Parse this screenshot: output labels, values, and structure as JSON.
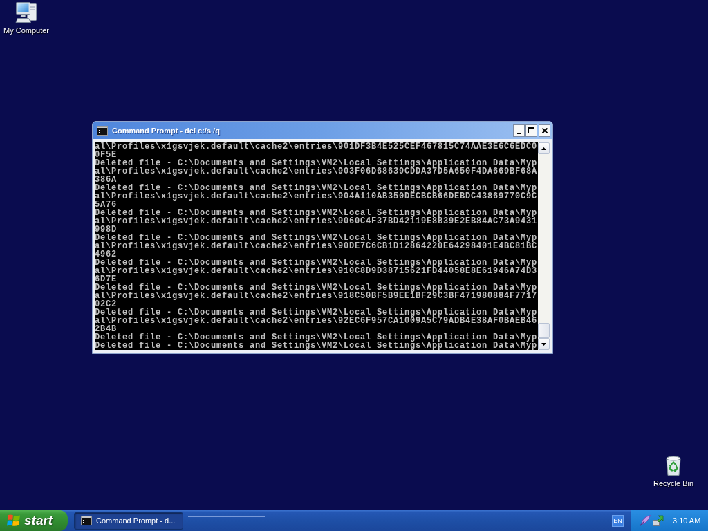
{
  "desktop": {
    "icons": [
      {
        "kind": "computer",
        "label": "My Computer"
      },
      {
        "kind": "recycle-bin",
        "label": "Recycle Bin"
      }
    ]
  },
  "window": {
    "title": "Command Prompt - del c:/s /q",
    "console_lines": [
      "al\\Profiles\\x1gsvjek.default\\cache2\\entries\\901DF3B4E525CEF467815C74AAE3E6C6EDC0",
      "0F5E",
      "Deleted file - C:\\Documents and Settings\\VM2\\Local Settings\\Application Data\\Myp",
      "al\\Profiles\\x1gsvjek.default\\cache2\\entries\\903F06D68639CDDA37D5A650F4DA669BF68A",
      "386A",
      "Deleted file - C:\\Documents and Settings\\VM2\\Local Settings\\Application Data\\Myp",
      "al\\Profiles\\x1gsvjek.default\\cache2\\entries\\904A110AB350DECBCB66DEBDC43869770C9C",
      "5A76",
      "Deleted file - C:\\Documents and Settings\\VM2\\Local Settings\\Application Data\\Myp",
      "al\\Profiles\\x1gsvjek.default\\cache2\\entries\\9060C4F37BD42119E8B39E2EB84AC73A9431",
      "998D",
      "Deleted file - C:\\Documents and Settings\\VM2\\Local Settings\\Application Data\\Myp",
      "al\\Profiles\\x1gsvjek.default\\cache2\\entries\\90DE7C6CB1D12864220E64298401E4BC81BC",
      "4962",
      "Deleted file - C:\\Documents and Settings\\VM2\\Local Settings\\Application Data\\Myp",
      "al\\Profiles\\x1gsvjek.default\\cache2\\entries\\910C8D9D38715621FD44058E8E61946A74D3",
      "6D7E",
      "Deleted file - C:\\Documents and Settings\\VM2\\Local Settings\\Application Data\\Myp",
      "al\\Profiles\\x1gsvjek.default\\cache2\\entries\\918C50BF5B9EE1BF29C3BF471980884F7717",
      "02C2",
      "Deleted file - C:\\Documents and Settings\\VM2\\Local Settings\\Application Data\\Myp",
      "al\\Profiles\\x1gsvjek.default\\cache2\\entries\\92EC6F957CA1009A5C79ADB4E38AF0BAEB46",
      "2B4B",
      "Deleted file - C:\\Documents and Settings\\VM2\\Local Settings\\Application Data\\Myp",
      "Deleted file - C:\\Documents and Settings\\VM2\\Local Settings\\Application Data\\Myp"
    ]
  },
  "taskbar": {
    "start_label": "start",
    "tasks": [
      {
        "label": "Command Prompt - d...",
        "selected": true
      }
    ],
    "language": "EN",
    "clock": "3:10 AM"
  }
}
